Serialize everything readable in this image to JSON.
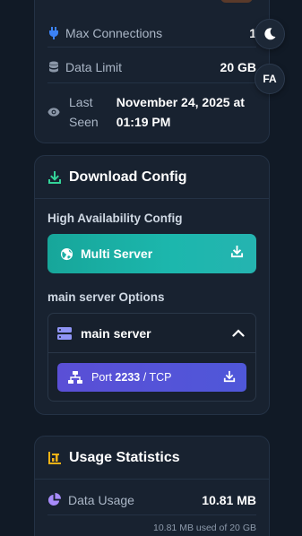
{
  "account": {
    "max_connections_label": "Max Connections",
    "max_connections_value": "1",
    "data_limit_label": "Data Limit",
    "data_limit_value": "20 GB",
    "last_seen_label_1": "Last",
    "last_seen_label_2": "Seen",
    "last_seen_value_1": "November 24, 2025 at",
    "last_seen_value_2": "01:19 PM"
  },
  "controls": {
    "theme_icon": "moon-icon",
    "language_label": "FA"
  },
  "download": {
    "title": "Download Config",
    "ha_label": "High Availability Config",
    "multi_server_label": "Multi Server",
    "options_label": "main server Options",
    "server_name": "main server",
    "port_prefix": "Port",
    "port_number": "2233",
    "port_suffix": "/ TCP"
  },
  "usage": {
    "title": "Usage Statistics",
    "data_usage_label": "Data Usage",
    "data_usage_value": "10.81 MB",
    "usage_detail": "10.81 MB used of 20 GB"
  },
  "colors": {
    "accent_teal": "#1cb7ad",
    "accent_indigo": "#5a4fd6",
    "download_icon": "#34d399",
    "usage_icon": "#f5b316",
    "server_icon": "#8f94f5",
    "pie_icon": "#a78bfa"
  }
}
